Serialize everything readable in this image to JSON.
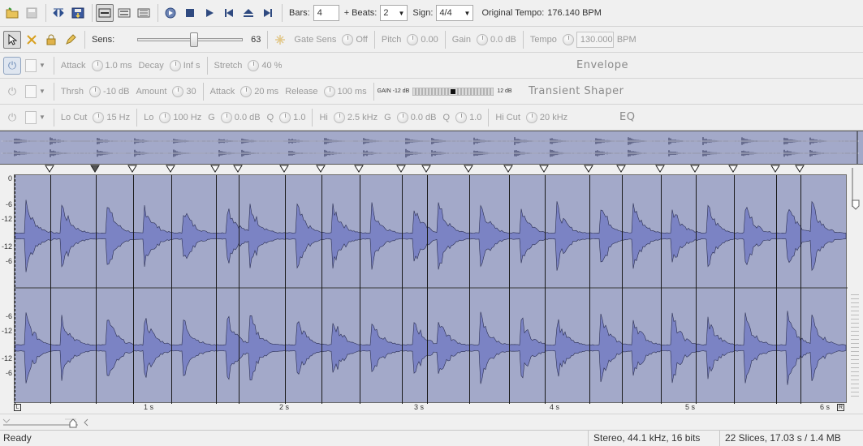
{
  "toolbar": {
    "bars_label": "Bars:",
    "bars_value": "4",
    "beats_label": "+ Beats:",
    "beats_value": "2",
    "sign_label": "Sign:",
    "sign_value": "4/4",
    "tempo_label": "Original Tempo:",
    "tempo_value": "176.140 BPM"
  },
  "row2": {
    "sens_label": "Sens:",
    "sens_value": "63",
    "sens_level": 0.63,
    "gate_label": "Gate Sens",
    "gate_value": "Off",
    "pitch_label": "Pitch",
    "pitch_value": "0.00",
    "gain_label": "Gain",
    "gain_value": "0.0 dB",
    "tempo_label": "Tempo",
    "tempo_value": "130.000",
    "tempo_unit": "BPM"
  },
  "envelope": {
    "attack_label": "Attack",
    "attack_value": "1.0 ms",
    "decay_label": "Decay",
    "decay_value": "Inf s",
    "stretch_label": "Stretch",
    "stretch_value": "40 %",
    "title": "Envelope"
  },
  "transient": {
    "thrsh_label": "Thrsh",
    "thrsh_value": "-10 dB",
    "amount_label": "Amount",
    "amount_value": "30",
    "attack_label": "Attack",
    "attack_value": "20 ms",
    "release_label": "Release",
    "release_value": "100 ms",
    "gain_meter_label": "GAIN -12 dB",
    "gain_meter_max": "12 dB",
    "title": "Transient Shaper"
  },
  "eq": {
    "locut_label": "Lo Cut",
    "locut_value": "15 Hz",
    "lo_label": "Lo",
    "lo_value": "100 Hz",
    "lo_g_label": "G",
    "lo_g_value": "0.0 dB",
    "lo_q_label": "Q",
    "lo_q_value": "1.0",
    "hi_label": "Hi",
    "hi_value": "2.5 kHz",
    "hi_g_label": "G",
    "hi_g_value": "0.0 dB",
    "hi_q_label": "Q",
    "hi_q_value": "1.0",
    "hicut_label": "Hi Cut",
    "hicut_value": "20 kHz",
    "title": "EQ"
  },
  "ruler": {
    "left_ticks": [
      "0",
      "-6",
      "-12",
      "-12",
      "-6",
      "-6",
      "-12",
      "-12",
      "-6"
    ],
    "time_labels": [
      "1 s",
      "2 s",
      "3 s",
      "4 s",
      "5 s",
      "6 s"
    ],
    "left_end": "L",
    "right_end": "R"
  },
  "status": {
    "ready": "Ready",
    "format": "Stereo, 44.1 kHz, 16 bits",
    "summary": "22 Slices, 17.03 s / 1.4 MB"
  },
  "colors": {
    "wave_bg": "#a3a9c9",
    "wave_fill": "#7b83c4",
    "wave_dark": "#2b2f52",
    "slice_line": "#1a1a1a"
  }
}
